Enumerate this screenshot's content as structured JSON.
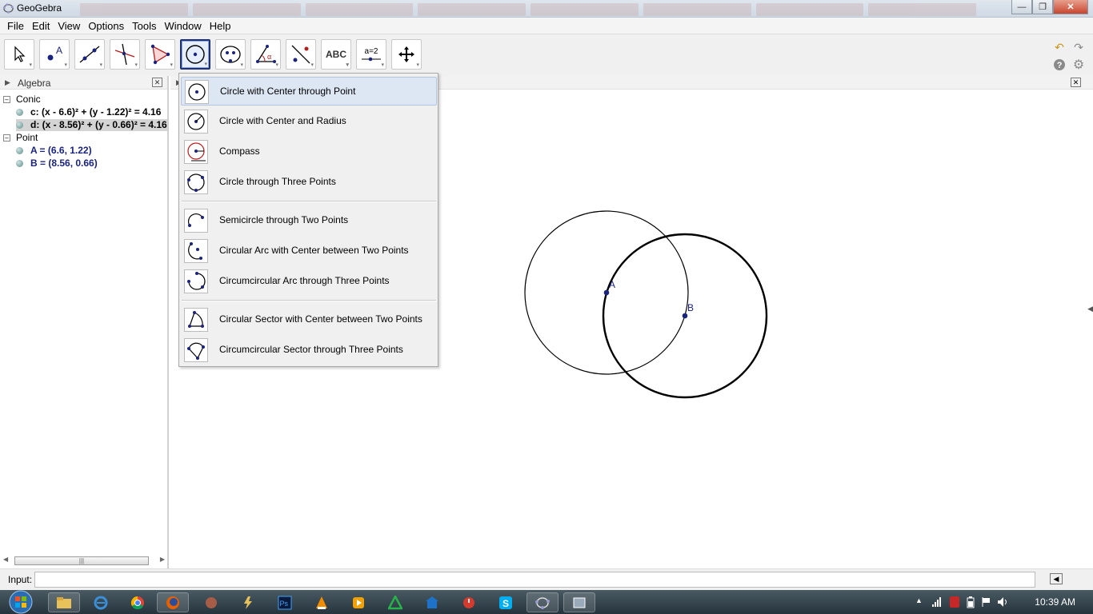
{
  "window": {
    "title": "GeoGebra"
  },
  "menu": [
    "File",
    "Edit",
    "View",
    "Options",
    "Tools",
    "Window",
    "Help"
  ],
  "toolbar": {
    "tools": [
      "move-tool",
      "point-tool",
      "line-tool",
      "perpendicular-tool",
      "polygon-tool",
      "circle-tool",
      "conic-tool",
      "angle-tool",
      "reflect-tool",
      "text-tool",
      "slider-tool",
      "move-graphics-tool"
    ],
    "text_tool_label": "ABC",
    "slider_tool_label": "a=2"
  },
  "algebra": {
    "title": "Algebra",
    "categories": [
      {
        "name": "Conic",
        "items": [
          "c: (x - 6.6)² + (y - 1.22)² = 4.16",
          "d: (x - 8.56)² + (y - 0.66)² = 4.16"
        ]
      },
      {
        "name": "Point",
        "items": [
          "A = (6.6, 1.22)",
          "B = (8.56, 0.66)"
        ]
      }
    ]
  },
  "circle_menu": {
    "items": [
      "Circle with Center through Point",
      "Circle with Center and Radius",
      "Compass",
      "Circle through Three Points",
      "Semicircle through Two Points",
      "Circular Arc with Center between Two Points",
      "Circumcircular Arc through Three Points",
      "Circular Sector with Center between Two Points",
      "Circumcircular Sector through Three Points"
    ]
  },
  "graphics": {
    "points": [
      {
        "label": "A"
      },
      {
        "label": "B"
      }
    ]
  },
  "input": {
    "label": "Input:"
  },
  "taskbar": {
    "clock": "10:39 AM"
  },
  "colors": {
    "point_blue": "#1a237e",
    "menu_highlight": "#dde6f3",
    "accent": "#1c2f7a"
  }
}
